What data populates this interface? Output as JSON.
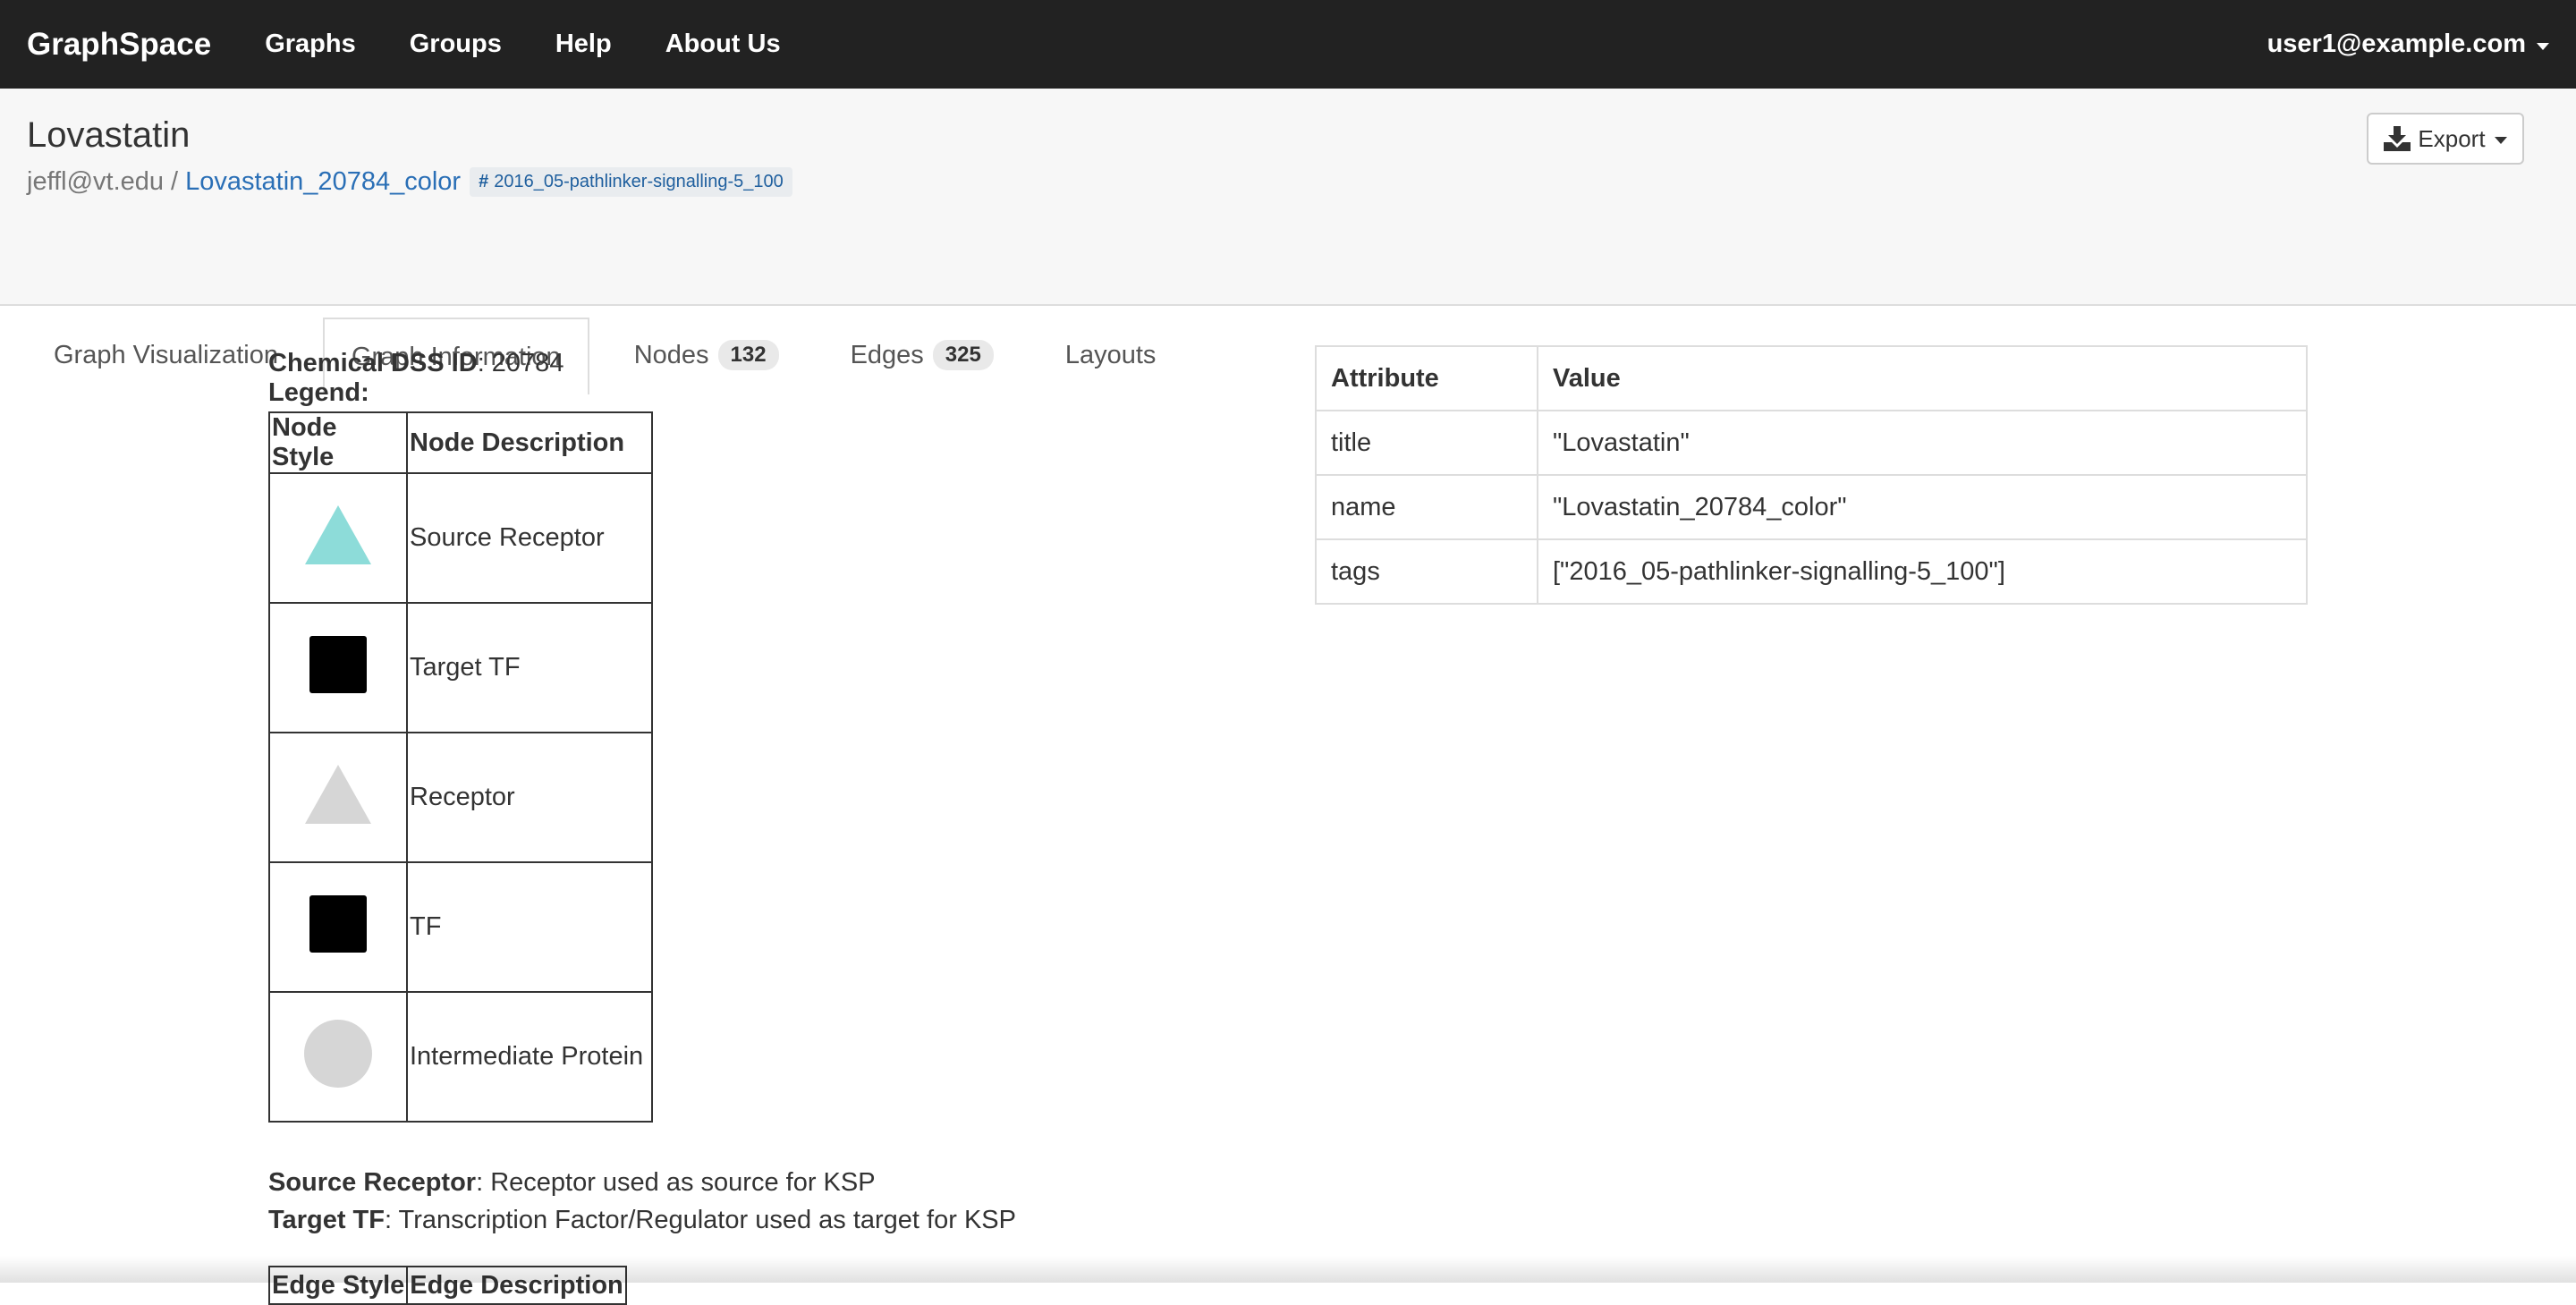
{
  "navbar": {
    "brand": "GraphSpace",
    "links": [
      "Graphs",
      "Groups",
      "Help",
      "About Us"
    ],
    "user": "user1@example.com"
  },
  "header": {
    "title": "Lovastatin",
    "owner": "jeffl@vt.edu",
    "separator": "/",
    "graph_name": "Lovastatin_20784_color",
    "tag": "2016_05-pathlinker-signalling-5_100",
    "export_label": "Export"
  },
  "tabs": [
    {
      "label": "Graph Visualization",
      "badge": ""
    },
    {
      "label": "Graph Information",
      "badge": ""
    },
    {
      "label": "Nodes",
      "badge": "132"
    },
    {
      "label": "Edges",
      "badge": "325"
    },
    {
      "label": "Layouts",
      "badge": ""
    }
  ],
  "info": {
    "chem_label": "Chemical DSS ID",
    "chem_value": ": 20784",
    "legend_label": "Legend:",
    "node_table": {
      "headers": [
        "Node Style",
        "Node Description"
      ],
      "rows": [
        {
          "shape": "triangle",
          "color": "#8ddcd9",
          "desc": "Source Receptor"
        },
        {
          "shape": "square",
          "color": "#000000",
          "desc": "Target TF"
        },
        {
          "shape": "triangle",
          "color": "#d6d6d6",
          "desc": "Receptor"
        },
        {
          "shape": "square",
          "color": "#000000",
          "desc": "TF"
        },
        {
          "shape": "circle",
          "color": "#d6d6d6",
          "desc": "Intermediate Protein"
        }
      ]
    },
    "notes": [
      {
        "term": "Source Receptor",
        "text": ": Receptor used as source for KSP"
      },
      {
        "term": "Target TF",
        "text": ": Transcription Factor/Regulator used as target for KSP"
      }
    ],
    "edge_table": {
      "headers": [
        "Edge Style",
        "Edge Description"
      ]
    }
  },
  "attributes": {
    "headers": [
      "Attribute",
      "Value"
    ],
    "rows": [
      {
        "key": "title",
        "value": "\"Lovastatin\""
      },
      {
        "key": "name",
        "value": "\"Lovastatin_20784_color\""
      },
      {
        "key": "tags",
        "value": "[\"2016_05-pathlinker-signalling-5_100\"]"
      }
    ]
  }
}
